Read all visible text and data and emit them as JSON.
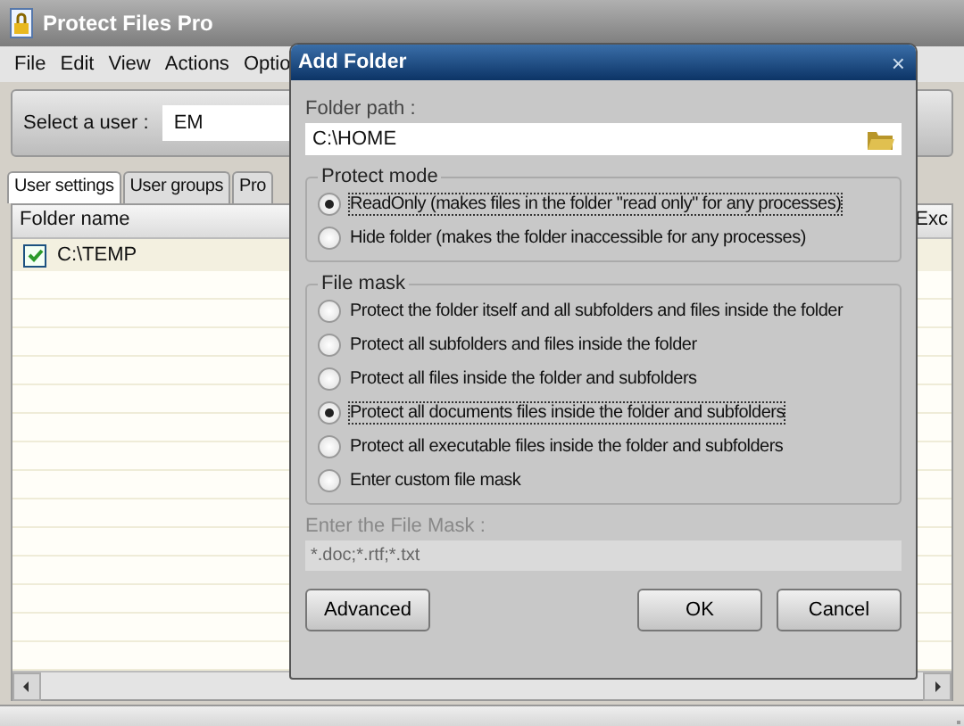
{
  "window": {
    "title": "Protect Files Pro"
  },
  "menu": [
    "File",
    "Edit",
    "View",
    "Actions",
    "Optio"
  ],
  "user_select": {
    "label": "Select a user :",
    "value": "EM"
  },
  "tabs": [
    {
      "label": "User settings",
      "selected": true
    },
    {
      "label": "User groups",
      "selected": false
    },
    {
      "label": "Pro",
      "selected": false
    }
  ],
  "table": {
    "columns": [
      "Folder name",
      "Exc"
    ],
    "rows": [
      {
        "folder": "C:\\TEMP",
        "checked": true
      }
    ]
  },
  "dialog": {
    "title": "Add Folder",
    "close": "×",
    "folder_path": {
      "label": "Folder path :",
      "value": "C:\\HOME"
    },
    "protect_mode": {
      "title": "Protect mode",
      "options": [
        {
          "label": "ReadOnly (makes files in the folder \"read only\" for any processes)",
          "selected": true
        },
        {
          "label": "Hide folder (makes the folder inaccessible for any processes)",
          "selected": false
        }
      ]
    },
    "file_mask": {
      "title": "File mask",
      "options": [
        {
          "label": "Protect the folder itself and all subfolders and files inside the folder",
          "selected": false
        },
        {
          "label": "Protect all subfolders and files inside the folder",
          "selected": false
        },
        {
          "label": "Protect all files inside the folder and subfolders",
          "selected": false
        },
        {
          "label": "Protect all documents files inside the folder and subfolders",
          "selected": true
        },
        {
          "label": "Protect all executable files inside the folder and subfolders",
          "selected": false
        },
        {
          "label": "Enter custom file mask",
          "selected": false
        }
      ]
    },
    "mask_field": {
      "label": "Enter the File Mask :",
      "value": "*.doc;*.rtf;*.txt",
      "disabled": true
    },
    "buttons": [
      "Advanced",
      "OK",
      "Cancel"
    ]
  }
}
